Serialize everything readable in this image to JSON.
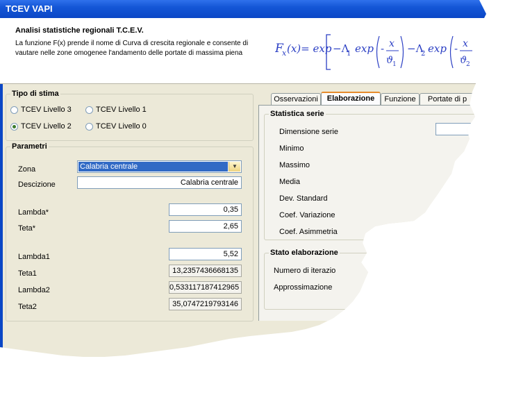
{
  "window": {
    "title": "TCEV VAPI"
  },
  "header": {
    "title": "Analisi statistiche regionali T.C.E.V.",
    "description": "La funzione F(x) prende il nome di Curva di crescita regionale e consente di vautare nelle zone omogenee l'andamento delle portate di massima piena"
  },
  "formula": {
    "lhs": "F",
    "lhs_sub": "x",
    "lhs_arg": "(x)= exp",
    "term1": "−Λ",
    "term1_sub": "1",
    "exp1": "exp",
    "frac1_num": "x",
    "frac1_den": "ϑ",
    "frac1_den_sub": "1",
    "term2": "−Λ",
    "term2_sub": "2",
    "exp2": "exp",
    "frac2_num": "x",
    "frac2_den": "ϑ",
    "frac2_den_sub": "2"
  },
  "tipo_stima": {
    "label": "Tipo di stima",
    "options": [
      {
        "label": "TCEV Livello 3",
        "checked": false
      },
      {
        "label": "TCEV Livello 1",
        "checked": false
      },
      {
        "label": "TCEV Livello 2",
        "checked": true
      },
      {
        "label": "TCEV Livello 0",
        "checked": false
      }
    ]
  },
  "parametri": {
    "label": "Parametri",
    "zona_label": "Zona",
    "zona_value": "Calabria centrale",
    "descrizione_label": "Descizione",
    "descrizione_value": "Calabria centrale",
    "lambda_star_label": "Lambda*",
    "lambda_star_value": "0,35",
    "teta_star_label": "Teta*",
    "teta_star_value": "2,65",
    "lambda1_label": "Lambda1",
    "lambda1_value": "5,52",
    "teta1_label": "Teta1",
    "teta1_value": "13,2357436668135",
    "lambda2_label": "Lambda2",
    "lambda2_value": "0,533117187412965",
    "teta2_label": "Teta2",
    "teta2_value": "35,0747219793146"
  },
  "tabs": [
    "Osservazioni",
    "Elaborazione",
    "Funzione",
    "Portate di p"
  ],
  "statistica": {
    "label": "Statistica serie",
    "rows": [
      "Dimensione serie",
      "Minimo",
      "Massimo",
      "Media",
      "Dev. Standard",
      "Coef. Variazione",
      "Coef.  Asimmetria"
    ]
  },
  "stato": {
    "label": "Stato elaborazione",
    "rows": [
      "Numero di iterazio",
      "Approssimazione"
    ]
  },
  "colors": {
    "title_bar": "#0b47c6",
    "formula": "#2b3fc4",
    "panel_bg": "#ece9d8"
  }
}
